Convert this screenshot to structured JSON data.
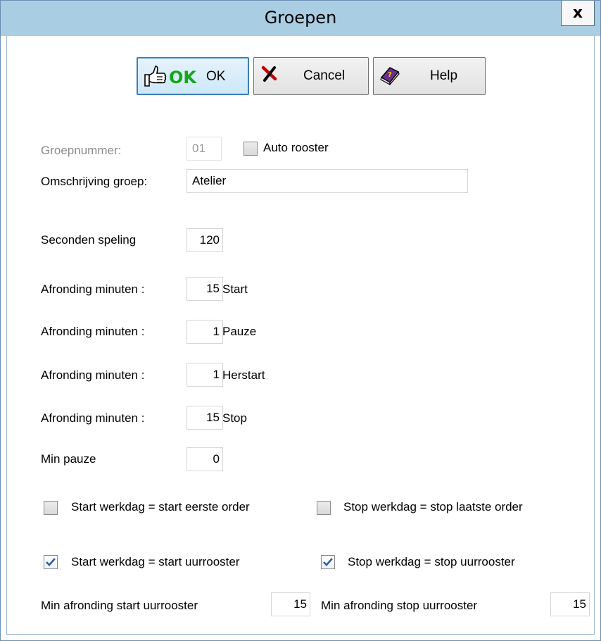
{
  "window": {
    "title": "Groepen",
    "close_label": "x"
  },
  "toolbar": {
    "ok_icon_text": "OK",
    "ok_label": "OK",
    "cancel_label": "Cancel",
    "help_label": "Help"
  },
  "form": {
    "groepnummer_label": "Groepnummer:",
    "groepnummer_value": "01",
    "auto_rooster_label": "Auto rooster",
    "auto_rooster_checked": false,
    "omschrijving_label": "Omschrijving groep:",
    "omschrijving_value": "Atelier",
    "seconden_label": "Seconden speling",
    "seconden_value": "120",
    "afronding": [
      {
        "label": "Afronding minuten :",
        "value": "15",
        "suffix": "Start"
      },
      {
        "label": "Afronding minuten :",
        "value": "1",
        "suffix": "Pauze"
      },
      {
        "label": "Afronding minuten :",
        "value": "1",
        "suffix": "Herstart"
      },
      {
        "label": "Afronding minuten :",
        "value": "15",
        "suffix": "Stop"
      }
    ],
    "min_pauze_label": "Min pauze",
    "min_pauze_value": "0",
    "start_eerste_order_label": "Start werkdag = start eerste order",
    "start_eerste_order_checked": false,
    "stop_laatste_order_label": "Stop werkdag = stop laatste order",
    "stop_laatste_order_checked": false,
    "start_uurrooster_label": "Start werkdag = start uurrooster",
    "start_uurrooster_checked": true,
    "stop_uurrooster_label": "Stop werkdag = stop uurrooster",
    "stop_uurrooster_checked": true,
    "min_afronding_start_label": "Min afronding start uurrooster",
    "min_afronding_start_value": "15",
    "min_afronding_stop_label": "Min afronding stop uurrooster",
    "min_afronding_stop_value": "15"
  },
  "colors": {
    "titlebar": "#a9cde2",
    "ok_button": "#cde8f9",
    "check": "#2a5fa8"
  }
}
